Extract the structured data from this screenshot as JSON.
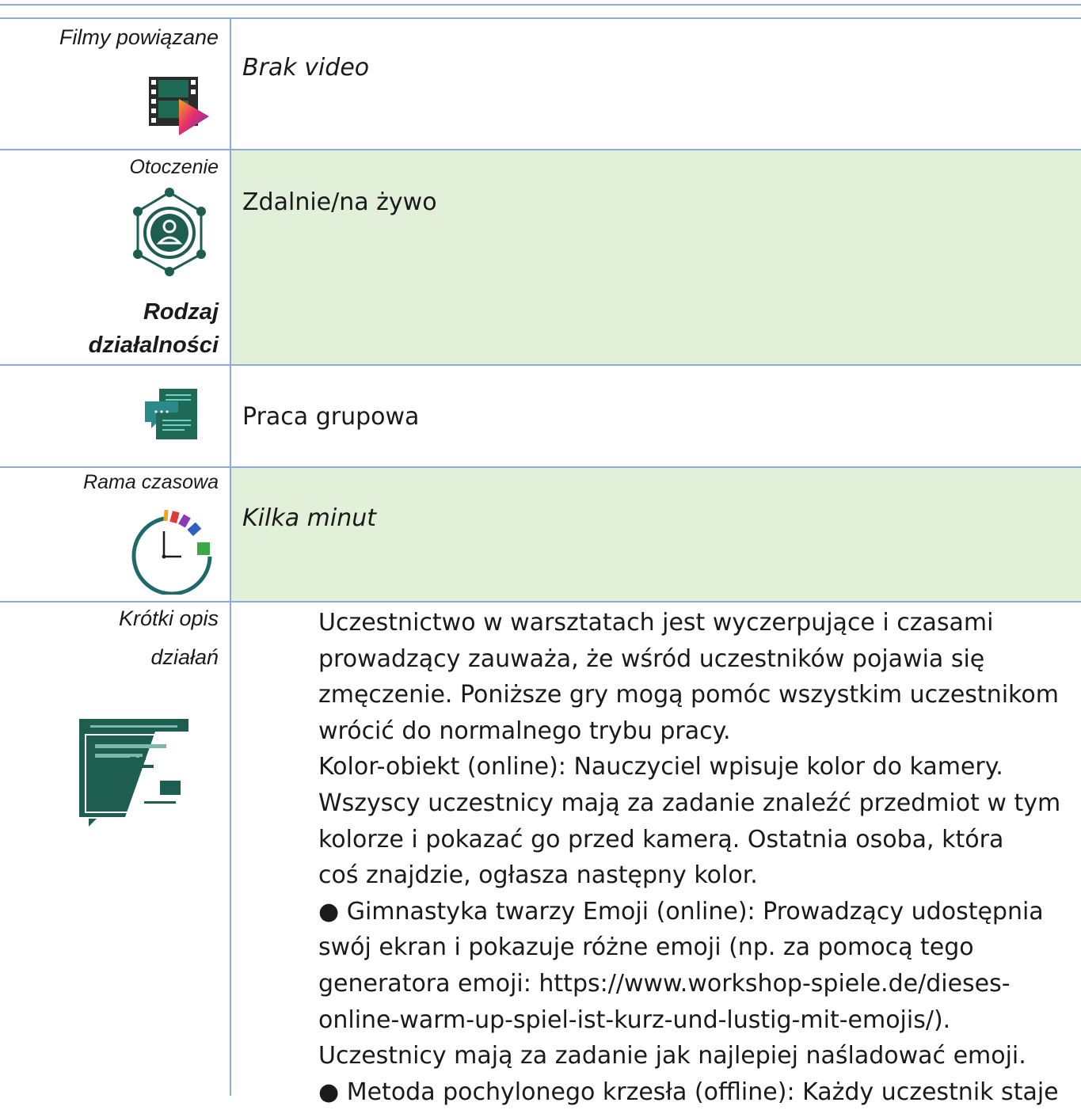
{
  "rows": {
    "videos": {
      "label": "Filmy powiązane",
      "value": "Brak video",
      "icon": "film-play-icon"
    },
    "environment": {
      "label": "Otoczenie",
      "value": "Zdalnie/na żywo",
      "icon": "network-person-icon"
    },
    "activity_type": {
      "label_line1": "Rodzaj",
      "label_line2": "działalności",
      "value": "Praca grupowa",
      "icon": "chat-bubbles-icon"
    },
    "timeframe": {
      "label": "Rama czasowa",
      "value": "Kilka minut",
      "icon": "clock-icon"
    },
    "description": {
      "label_line1": "Krótki opis",
      "label_line2": "działań",
      "icon": "document-window-icon",
      "lines": [
        "Uczestnictwo w warsztatach jest wyczerpujące i czasami",
        "prowadzący zauważa, że wśród uczestników pojawia się",
        "zmęczenie. Poniższe gry mogą pomóc wszystkim uczestnikom",
        "wrócić do normalnego trybu pracy.",
        "Kolor-obiekt (online): Nauczyciel wpisuje kolor do kamery.",
        "Wszyscy uczestnicy mają za zadanie znaleźć przedmiot w tym",
        "kolorze i pokazać go przed kamerą. Ostatnia osoba, która",
        "coś znajdzie, ogłasza następny kolor.",
        "● Gimnastyka twarzy Emoji (online): Prowadzący udostępnia",
        "swój ekran i pokazuje różne emoji (np. za pomocą tego",
        "generatora emoji: https://www.workshop-spiele.de/dieses-",
        "online-warm-up-spiel-ist-kurz-und-lustig-mit-emojis/).",
        "Uczestnicy mają za zadanie jak najlepiej naśladować emoji.",
        "● Metoda pochylonego krzesła (offline): Każdy uczestnik staje"
      ]
    }
  },
  "colors": {
    "border": "#8ea9db",
    "highlight": "#e2efd9",
    "icon_green": "#1e5e50"
  }
}
